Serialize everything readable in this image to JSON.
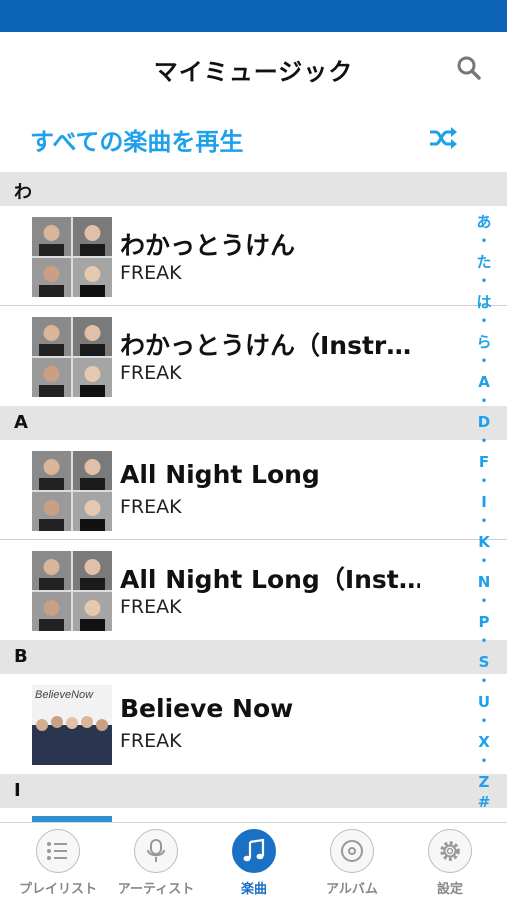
{
  "header": {
    "title": "マイミュージック"
  },
  "play_all": {
    "label": "すべての楽曲を再生"
  },
  "sections": [
    {
      "letter": "わ",
      "songs": [
        {
          "title": "わかっとうけん",
          "artist": "FREAK"
        },
        {
          "title": "わかっとうけん（Instr…",
          "artist": "FREAK"
        }
      ]
    },
    {
      "letter": "A",
      "songs": [
        {
          "title": "All Night Long",
          "artist": "FREAK"
        },
        {
          "title": "All Night Long（Inst…",
          "artist": "FREAK"
        }
      ]
    },
    {
      "letter": "B",
      "songs": [
        {
          "title": "Believe Now",
          "artist": "FREAK",
          "art_text": "BelieveNow"
        }
      ]
    },
    {
      "letter": "I"
    }
  ],
  "index_letters": [
    "あ",
    "•",
    "た",
    "•",
    "は",
    "•",
    "ら",
    "•",
    "A",
    "•",
    "D",
    "•",
    "F",
    "•",
    "I",
    "•",
    "K",
    "•",
    "N",
    "•",
    "P",
    "•",
    "S",
    "•",
    "U",
    "•",
    "X",
    "•",
    "Z",
    "#"
  ],
  "tabs": [
    {
      "label": "プレイリスト",
      "icon": "playlist-icon"
    },
    {
      "label": "アーティスト",
      "icon": "microphone-icon"
    },
    {
      "label": "楽曲",
      "icon": "music-note-icon",
      "active": true
    },
    {
      "label": "アルバム",
      "icon": "disc-icon"
    },
    {
      "label": "設定",
      "icon": "gear-icon"
    }
  ],
  "colors": {
    "status_bar": "#0d63b5",
    "accent": "#1ea1ea",
    "active_tab": "#1a71c4",
    "section_bg": "#e4e4e4"
  }
}
